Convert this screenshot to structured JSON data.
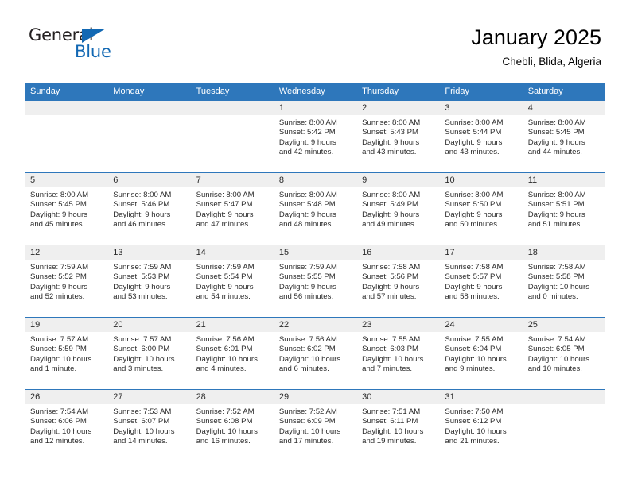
{
  "logo": {
    "word1": "General",
    "word2": "Blue",
    "triangle_color": "#1268b3",
    "icon": "triangle-icon"
  },
  "header": {
    "title": "January 2025",
    "subtitle": "Chebli, Blida, Algeria"
  },
  "colors": {
    "header_blue": "#2e77bb",
    "daynum_strip": "#efefef",
    "text": "#2b2b2b"
  },
  "calendar": {
    "weekday_headers": [
      "Sunday",
      "Monday",
      "Tuesday",
      "Wednesday",
      "Thursday",
      "Friday",
      "Saturday"
    ],
    "weeks": [
      [
        {
          "day": "",
          "lines": []
        },
        {
          "day": "",
          "lines": []
        },
        {
          "day": "",
          "lines": []
        },
        {
          "day": "1",
          "lines": [
            "Sunrise: 8:00 AM",
            "Sunset: 5:42 PM",
            "Daylight: 9 hours",
            "and 42 minutes."
          ]
        },
        {
          "day": "2",
          "lines": [
            "Sunrise: 8:00 AM",
            "Sunset: 5:43 PM",
            "Daylight: 9 hours",
            "and 43 minutes."
          ]
        },
        {
          "day": "3",
          "lines": [
            "Sunrise: 8:00 AM",
            "Sunset: 5:44 PM",
            "Daylight: 9 hours",
            "and 43 minutes."
          ]
        },
        {
          "day": "4",
          "lines": [
            "Sunrise: 8:00 AM",
            "Sunset: 5:45 PM",
            "Daylight: 9 hours",
            "and 44 minutes."
          ]
        }
      ],
      [
        {
          "day": "5",
          "lines": [
            "Sunrise: 8:00 AM",
            "Sunset: 5:45 PM",
            "Daylight: 9 hours",
            "and 45 minutes."
          ]
        },
        {
          "day": "6",
          "lines": [
            "Sunrise: 8:00 AM",
            "Sunset: 5:46 PM",
            "Daylight: 9 hours",
            "and 46 minutes."
          ]
        },
        {
          "day": "7",
          "lines": [
            "Sunrise: 8:00 AM",
            "Sunset: 5:47 PM",
            "Daylight: 9 hours",
            "and 47 minutes."
          ]
        },
        {
          "day": "8",
          "lines": [
            "Sunrise: 8:00 AM",
            "Sunset: 5:48 PM",
            "Daylight: 9 hours",
            "and 48 minutes."
          ]
        },
        {
          "day": "9",
          "lines": [
            "Sunrise: 8:00 AM",
            "Sunset: 5:49 PM",
            "Daylight: 9 hours",
            "and 49 minutes."
          ]
        },
        {
          "day": "10",
          "lines": [
            "Sunrise: 8:00 AM",
            "Sunset: 5:50 PM",
            "Daylight: 9 hours",
            "and 50 minutes."
          ]
        },
        {
          "day": "11",
          "lines": [
            "Sunrise: 8:00 AM",
            "Sunset: 5:51 PM",
            "Daylight: 9 hours",
            "and 51 minutes."
          ]
        }
      ],
      [
        {
          "day": "12",
          "lines": [
            "Sunrise: 7:59 AM",
            "Sunset: 5:52 PM",
            "Daylight: 9 hours",
            "and 52 minutes."
          ]
        },
        {
          "day": "13",
          "lines": [
            "Sunrise: 7:59 AM",
            "Sunset: 5:53 PM",
            "Daylight: 9 hours",
            "and 53 minutes."
          ]
        },
        {
          "day": "14",
          "lines": [
            "Sunrise: 7:59 AM",
            "Sunset: 5:54 PM",
            "Daylight: 9 hours",
            "and 54 minutes."
          ]
        },
        {
          "day": "15",
          "lines": [
            "Sunrise: 7:59 AM",
            "Sunset: 5:55 PM",
            "Daylight: 9 hours",
            "and 56 minutes."
          ]
        },
        {
          "day": "16",
          "lines": [
            "Sunrise: 7:58 AM",
            "Sunset: 5:56 PM",
            "Daylight: 9 hours",
            "and 57 minutes."
          ]
        },
        {
          "day": "17",
          "lines": [
            "Sunrise: 7:58 AM",
            "Sunset: 5:57 PM",
            "Daylight: 9 hours",
            "and 58 minutes."
          ]
        },
        {
          "day": "18",
          "lines": [
            "Sunrise: 7:58 AM",
            "Sunset: 5:58 PM",
            "Daylight: 10 hours",
            "and 0 minutes."
          ]
        }
      ],
      [
        {
          "day": "19",
          "lines": [
            "Sunrise: 7:57 AM",
            "Sunset: 5:59 PM",
            "Daylight: 10 hours",
            "and 1 minute."
          ]
        },
        {
          "day": "20",
          "lines": [
            "Sunrise: 7:57 AM",
            "Sunset: 6:00 PM",
            "Daylight: 10 hours",
            "and 3 minutes."
          ]
        },
        {
          "day": "21",
          "lines": [
            "Sunrise: 7:56 AM",
            "Sunset: 6:01 PM",
            "Daylight: 10 hours",
            "and 4 minutes."
          ]
        },
        {
          "day": "22",
          "lines": [
            "Sunrise: 7:56 AM",
            "Sunset: 6:02 PM",
            "Daylight: 10 hours",
            "and 6 minutes."
          ]
        },
        {
          "day": "23",
          "lines": [
            "Sunrise: 7:55 AM",
            "Sunset: 6:03 PM",
            "Daylight: 10 hours",
            "and 7 minutes."
          ]
        },
        {
          "day": "24",
          "lines": [
            "Sunrise: 7:55 AM",
            "Sunset: 6:04 PM",
            "Daylight: 10 hours",
            "and 9 minutes."
          ]
        },
        {
          "day": "25",
          "lines": [
            "Sunrise: 7:54 AM",
            "Sunset: 6:05 PM",
            "Daylight: 10 hours",
            "and 10 minutes."
          ]
        }
      ],
      [
        {
          "day": "26",
          "lines": [
            "Sunrise: 7:54 AM",
            "Sunset: 6:06 PM",
            "Daylight: 10 hours",
            "and 12 minutes."
          ]
        },
        {
          "day": "27",
          "lines": [
            "Sunrise: 7:53 AM",
            "Sunset: 6:07 PM",
            "Daylight: 10 hours",
            "and 14 minutes."
          ]
        },
        {
          "day": "28",
          "lines": [
            "Sunrise: 7:52 AM",
            "Sunset: 6:08 PM",
            "Daylight: 10 hours",
            "and 16 minutes."
          ]
        },
        {
          "day": "29",
          "lines": [
            "Sunrise: 7:52 AM",
            "Sunset: 6:09 PM",
            "Daylight: 10 hours",
            "and 17 minutes."
          ]
        },
        {
          "day": "30",
          "lines": [
            "Sunrise: 7:51 AM",
            "Sunset: 6:11 PM",
            "Daylight: 10 hours",
            "and 19 minutes."
          ]
        },
        {
          "day": "31",
          "lines": [
            "Sunrise: 7:50 AM",
            "Sunset: 6:12 PM",
            "Daylight: 10 hours",
            "and 21 minutes."
          ]
        },
        {
          "day": "",
          "lines": []
        }
      ]
    ]
  }
}
